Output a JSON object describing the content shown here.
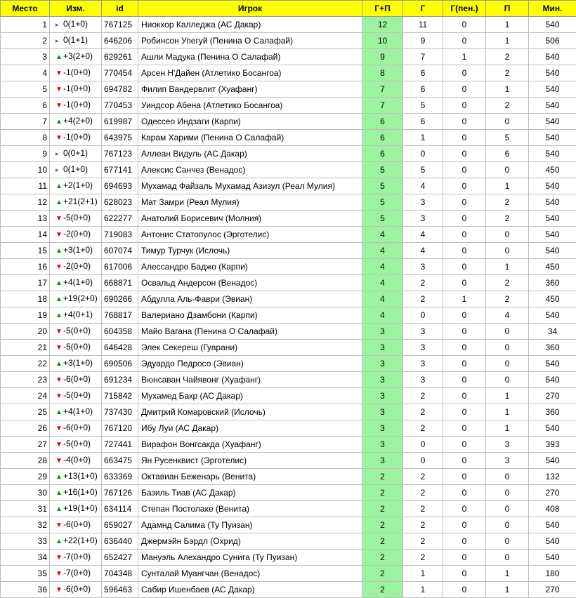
{
  "headers": {
    "rank": "Место",
    "change": "Изм.",
    "id": "id",
    "player": "Игрок",
    "gp": "Г+П",
    "goals": "Г",
    "pen": "Г(пен.)",
    "assists": "П",
    "minutes": "Мин."
  },
  "colors": {
    "header_bg": "#ffff00",
    "gp_bg": "#9df29f",
    "up": "#0a8a0a",
    "down": "#e00000",
    "same": "#1f5fd6"
  },
  "icons": {
    "up": "triangle-up-icon",
    "down": "triangle-down-icon",
    "same": "flag-pointer-icon"
  },
  "rows": [
    {
      "rank": "1",
      "dir": "same",
      "change": "0(1+0)",
      "id": "767125",
      "player": "Ниокхор Калледжа (АС Дакар)",
      "gp": "12",
      "goals": "11",
      "pen": "0",
      "assists": "1",
      "minutes": "540"
    },
    {
      "rank": "2",
      "dir": "same",
      "change": "0(1+1)",
      "id": "646206",
      "player": "Робинсон Упегуй (Пенина О Салафай)",
      "gp": "10",
      "goals": "9",
      "pen": "0",
      "assists": "1",
      "minutes": "506"
    },
    {
      "rank": "3",
      "dir": "up",
      "change": "+3(2+0)",
      "id": "629261",
      "player": "Ашли Мадука (Пенина О Салафай)",
      "gp": "9",
      "goals": "7",
      "pen": "1",
      "assists": "2",
      "minutes": "540"
    },
    {
      "rank": "4",
      "dir": "down",
      "change": "-1(0+0)",
      "id": "770454",
      "player": "Арсен Н'Дайен (Атлетико Босангоа)",
      "gp": "8",
      "goals": "6",
      "pen": "0",
      "assists": "2",
      "minutes": "540"
    },
    {
      "rank": "5",
      "dir": "down",
      "change": "-1(0+0)",
      "id": "694782",
      "player": "Филип Вандервлит (Хуафанг)",
      "gp": "7",
      "goals": "6",
      "pen": "0",
      "assists": "1",
      "minutes": "540"
    },
    {
      "rank": "6",
      "dir": "down",
      "change": "-1(0+0)",
      "id": "770453",
      "player": "Уиндсор Абена (Атлетико Босангоа)",
      "gp": "7",
      "goals": "5",
      "pen": "0",
      "assists": "2",
      "minutes": "540"
    },
    {
      "rank": "7",
      "dir": "up",
      "change": "+4(2+0)",
      "id": "619987",
      "player": "Одессео Индзаги (Карпи)",
      "gp": "6",
      "goals": "6",
      "pen": "0",
      "assists": "0",
      "minutes": "540"
    },
    {
      "rank": "8",
      "dir": "down",
      "change": "-1(0+0)",
      "id": "643975",
      "player": "Карам Харими (Пенина О Салафай)",
      "gp": "6",
      "goals": "1",
      "pen": "0",
      "assists": "5",
      "minutes": "540"
    },
    {
      "rank": "9",
      "dir": "same",
      "change": "0(0+1)",
      "id": "767123",
      "player": "Аллеан Видуль (АС Дакар)",
      "gp": "6",
      "goals": "0",
      "pen": "0",
      "assists": "6",
      "minutes": "540"
    },
    {
      "rank": "10",
      "dir": "same",
      "change": "0(1+0)",
      "id": "677141",
      "player": "Алексис Санчез (Венадос)",
      "gp": "5",
      "goals": "5",
      "pen": "0",
      "assists": "0",
      "minutes": "450"
    },
    {
      "rank": "11",
      "dir": "up",
      "change": "+2(1+0)",
      "id": "694693",
      "player": "Мухамад Файзаль Мухамад Азизул (Реал Мулия)",
      "gp": "5",
      "goals": "4",
      "pen": "0",
      "assists": "1",
      "minutes": "540"
    },
    {
      "rank": "12",
      "dir": "up",
      "change": "+21(2+1)",
      "id": "628023",
      "player": "Мат Замри (Реал Мулия)",
      "gp": "5",
      "goals": "3",
      "pen": "0",
      "assists": "2",
      "minutes": "540"
    },
    {
      "rank": "13",
      "dir": "down",
      "change": "-5(0+0)",
      "id": "622277",
      "player": "Анатолий Борисевич (Молния)",
      "gp": "5",
      "goals": "3",
      "pen": "0",
      "assists": "2",
      "minutes": "540"
    },
    {
      "rank": "14",
      "dir": "down",
      "change": "-2(0+0)",
      "id": "719083",
      "player": "Антонис Статопулос (Эрготелис)",
      "gp": "4",
      "goals": "4",
      "pen": "0",
      "assists": "0",
      "minutes": "540"
    },
    {
      "rank": "15",
      "dir": "up",
      "change": "+3(1+0)",
      "id": "607074",
      "player": "Тимур Турчук (Ислочь)",
      "gp": "4",
      "goals": "4",
      "pen": "0",
      "assists": "0",
      "minutes": "540"
    },
    {
      "rank": "16",
      "dir": "down",
      "change": "-2(0+0)",
      "id": "617006",
      "player": "Алессандро Баджо (Карпи)",
      "gp": "4",
      "goals": "3",
      "pen": "0",
      "assists": "1",
      "minutes": "450"
    },
    {
      "rank": "17",
      "dir": "up",
      "change": "+4(1+0)",
      "id": "668871",
      "player": "Освальд Андерсон (Венадос)",
      "gp": "4",
      "goals": "2",
      "pen": "0",
      "assists": "2",
      "minutes": "360"
    },
    {
      "rank": "18",
      "dir": "up",
      "change": "+19(2+0)",
      "id": "690266",
      "player": "Абдулла Аль-Фаври (Эвиан)",
      "gp": "4",
      "goals": "2",
      "pen": "1",
      "assists": "2",
      "minutes": "450"
    },
    {
      "rank": "19",
      "dir": "up",
      "change": "+4(0+1)",
      "id": "768817",
      "player": "Валериано Дзамбони (Карпи)",
      "gp": "4",
      "goals": "0",
      "pen": "0",
      "assists": "4",
      "minutes": "540"
    },
    {
      "rank": "20",
      "dir": "down",
      "change": "-5(0+0)",
      "id": "604358",
      "player": "Майо Вагана (Пенина О Салафай)",
      "gp": "3",
      "goals": "3",
      "pen": "0",
      "assists": "0",
      "minutes": "34"
    },
    {
      "rank": "21",
      "dir": "down",
      "change": "-5(0+0)",
      "id": "646428",
      "player": "Элек Секереш (Гуарани)",
      "gp": "3",
      "goals": "3",
      "pen": "0",
      "assists": "0",
      "minutes": "360"
    },
    {
      "rank": "22",
      "dir": "up",
      "change": "+3(1+0)",
      "id": "690506",
      "player": "Эдуардо Педросо (Эвиан)",
      "gp": "3",
      "goals": "3",
      "pen": "0",
      "assists": "0",
      "minutes": "540"
    },
    {
      "rank": "23",
      "dir": "down",
      "change": "-6(0+0)",
      "id": "691234",
      "player": "Вюнсаван Чайявонг (Хуафанг)",
      "gp": "3",
      "goals": "3",
      "pen": "0",
      "assists": "0",
      "minutes": "540"
    },
    {
      "rank": "24",
      "dir": "down",
      "change": "-5(0+0)",
      "id": "715842",
      "player": "Мухамед Бакр (АС Дакар)",
      "gp": "3",
      "goals": "2",
      "pen": "0",
      "assists": "1",
      "minutes": "270"
    },
    {
      "rank": "25",
      "dir": "up",
      "change": "+4(1+0)",
      "id": "737430",
      "player": "Дмитрий Комаровский (Ислочь)",
      "gp": "3",
      "goals": "2",
      "pen": "0",
      "assists": "1",
      "minutes": "360"
    },
    {
      "rank": "26",
      "dir": "down",
      "change": "-6(0+0)",
      "id": "767120",
      "player": "Ибу Луи (АС Дакар)",
      "gp": "3",
      "goals": "2",
      "pen": "0",
      "assists": "1",
      "minutes": "540"
    },
    {
      "rank": "27",
      "dir": "down",
      "change": "-5(0+0)",
      "id": "727441",
      "player": "Вирафон Вонгсакда (Хуафанг)",
      "gp": "3",
      "goals": "0",
      "pen": "0",
      "assists": "3",
      "minutes": "393"
    },
    {
      "rank": "28",
      "dir": "down",
      "change": "-4(0+0)",
      "id": "663475",
      "player": "Ян Русенквист (Эрготелис)",
      "gp": "3",
      "goals": "0",
      "pen": "0",
      "assists": "3",
      "minutes": "540"
    },
    {
      "rank": "29",
      "dir": "up",
      "change": "+13(1+0)",
      "id": "633369",
      "player": "Октавиан Беженарь (Венита)",
      "gp": "2",
      "goals": "2",
      "pen": "0",
      "assists": "0",
      "minutes": "132"
    },
    {
      "rank": "30",
      "dir": "up",
      "change": "+16(1+0)",
      "id": "767126",
      "player": "Базиль Тиав (АС Дакар)",
      "gp": "2",
      "goals": "2",
      "pen": "0",
      "assists": "0",
      "minutes": "270"
    },
    {
      "rank": "31",
      "dir": "up",
      "change": "+19(1+0)",
      "id": "634114",
      "player": "Степан Постолаке (Венита)",
      "gp": "2",
      "goals": "2",
      "pen": "0",
      "assists": "0",
      "minutes": "408"
    },
    {
      "rank": "32",
      "dir": "down",
      "change": "-6(0+0)",
      "id": "659027",
      "player": "Адамнд Салима (Ту Пуизан)",
      "gp": "2",
      "goals": "2",
      "pen": "0",
      "assists": "0",
      "minutes": "540"
    },
    {
      "rank": "33",
      "dir": "up",
      "change": "+22(1+0)",
      "id": "636440",
      "player": "Джермэйн Бэрдл (Охрид)",
      "gp": "2",
      "goals": "2",
      "pen": "0",
      "assists": "0",
      "minutes": "540"
    },
    {
      "rank": "34",
      "dir": "down",
      "change": "-7(0+0)",
      "id": "652427",
      "player": "Мануэль Алехандро Сунига (Ту Пуизан)",
      "gp": "2",
      "goals": "2",
      "pen": "0",
      "assists": "0",
      "minutes": "540"
    },
    {
      "rank": "35",
      "dir": "down",
      "change": "-7(0+0)",
      "id": "704348",
      "player": "Сунталай Муангчан (Венадос)",
      "gp": "2",
      "goals": "1",
      "pen": "0",
      "assists": "1",
      "minutes": "180"
    },
    {
      "rank": "36",
      "dir": "down",
      "change": "-6(0+0)",
      "id": "596463",
      "player": "Сабир Ишенбаев (АС Дакар)",
      "gp": "2",
      "goals": "1",
      "pen": "0",
      "assists": "1",
      "minutes": "270"
    }
  ]
}
